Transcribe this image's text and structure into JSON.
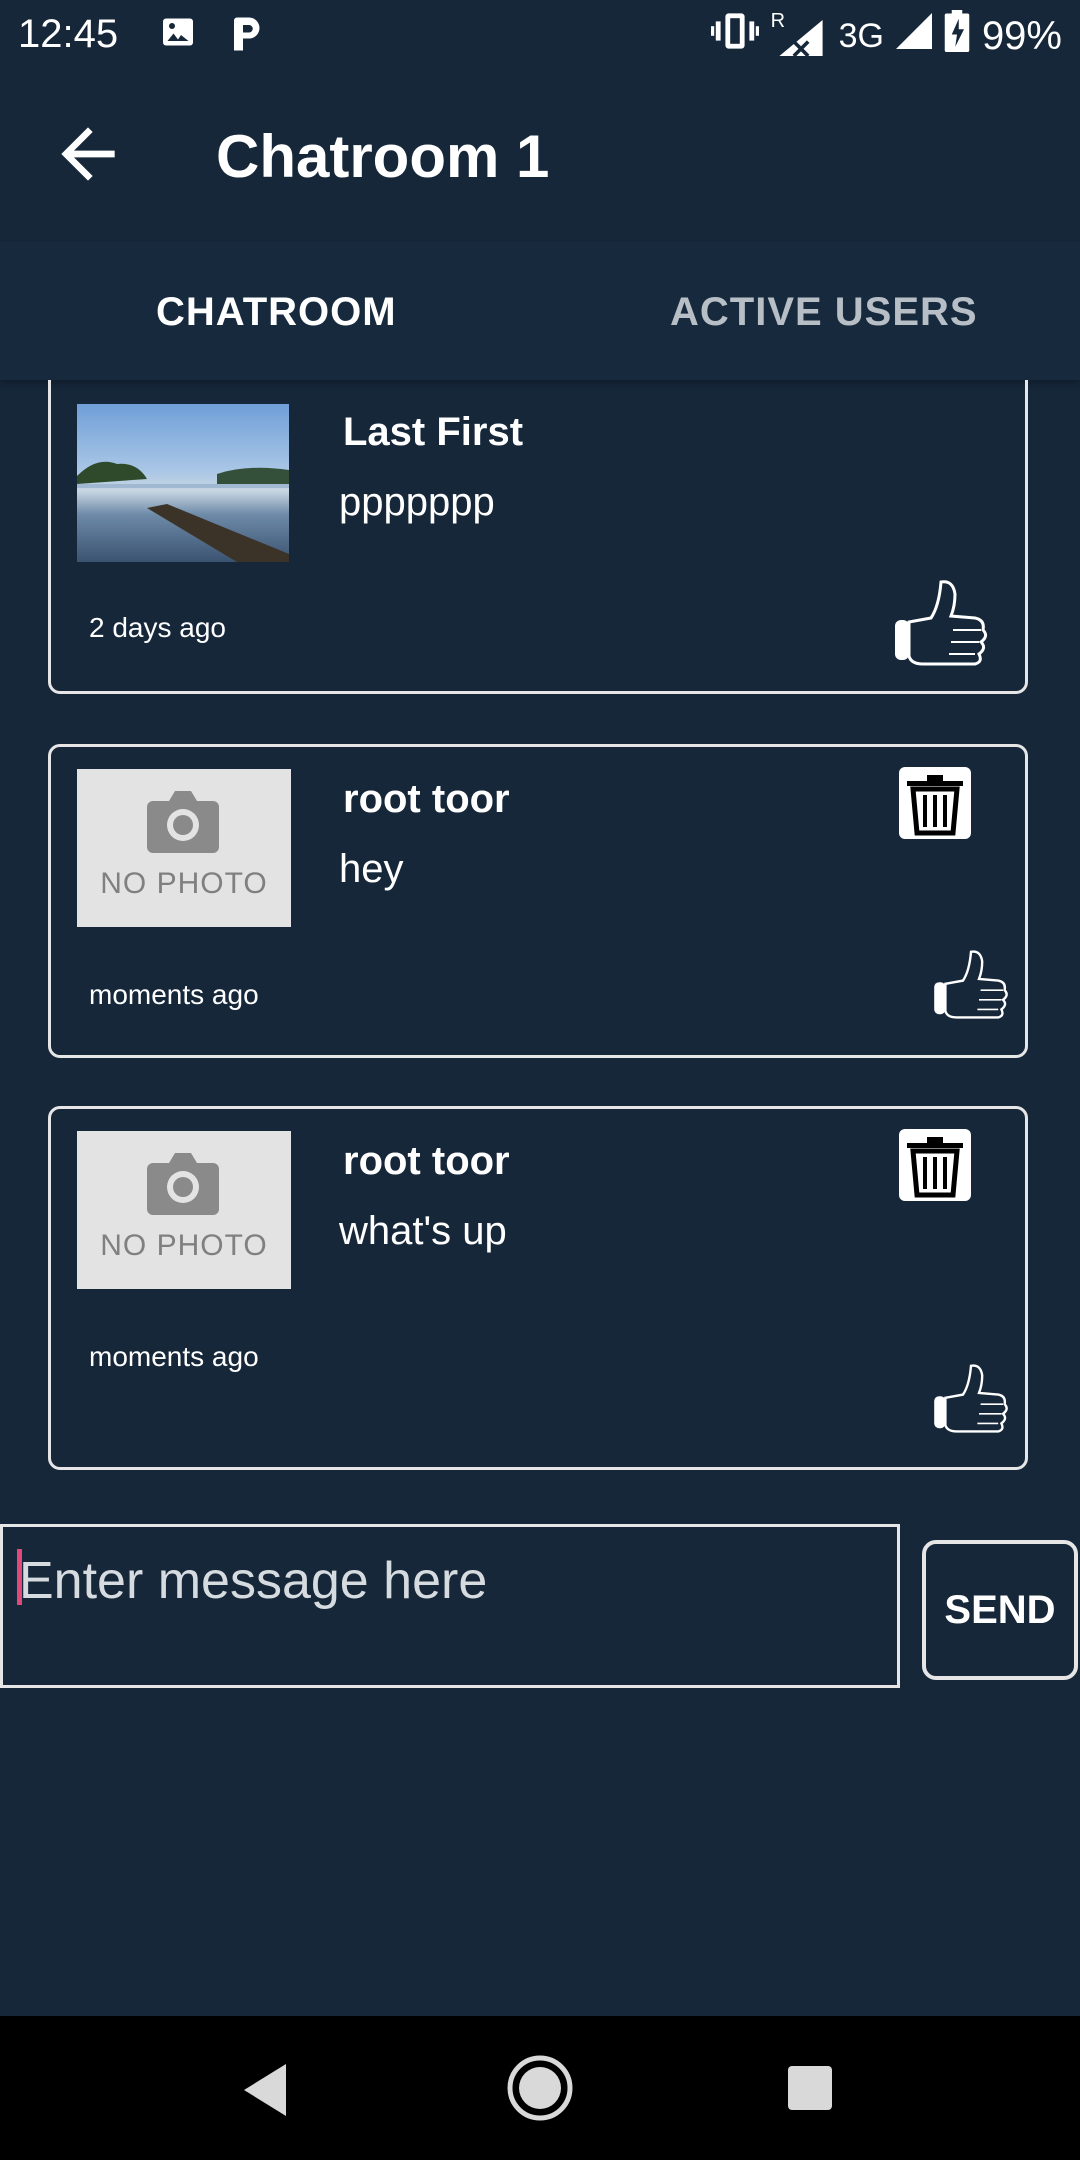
{
  "status_bar": {
    "time": "12:45",
    "network": "3G",
    "roaming": "R",
    "battery": "99%",
    "icons": [
      "image-icon",
      "parking-app-icon",
      "vibrate-icon",
      "signal-roaming-icon",
      "signal-icon",
      "battery-charging-icon"
    ]
  },
  "app_bar": {
    "title": "Chatroom 1"
  },
  "tabs": [
    {
      "label": "CHATROOM",
      "active": true
    },
    {
      "label": "ACTIVE USERS",
      "active": false
    }
  ],
  "messages": [
    {
      "name": "Last First",
      "text": "ppppppp",
      "time": "2 days ago",
      "avatar": "photo",
      "deletable": false
    },
    {
      "name": "root toor",
      "text": "hey",
      "time": "moments ago",
      "avatar": "no-photo",
      "avatar_label": "NO PHOTO",
      "deletable": true
    },
    {
      "name": "root toor",
      "text": "what's up",
      "time": "moments ago",
      "avatar": "no-photo",
      "avatar_label": "NO PHOTO",
      "deletable": true
    }
  ],
  "composer": {
    "placeholder": "Enter message here",
    "send_label": "SEND"
  },
  "colors": {
    "background": "#16273a",
    "border": "#e6e6e6",
    "cursor": "#e04a7a"
  }
}
